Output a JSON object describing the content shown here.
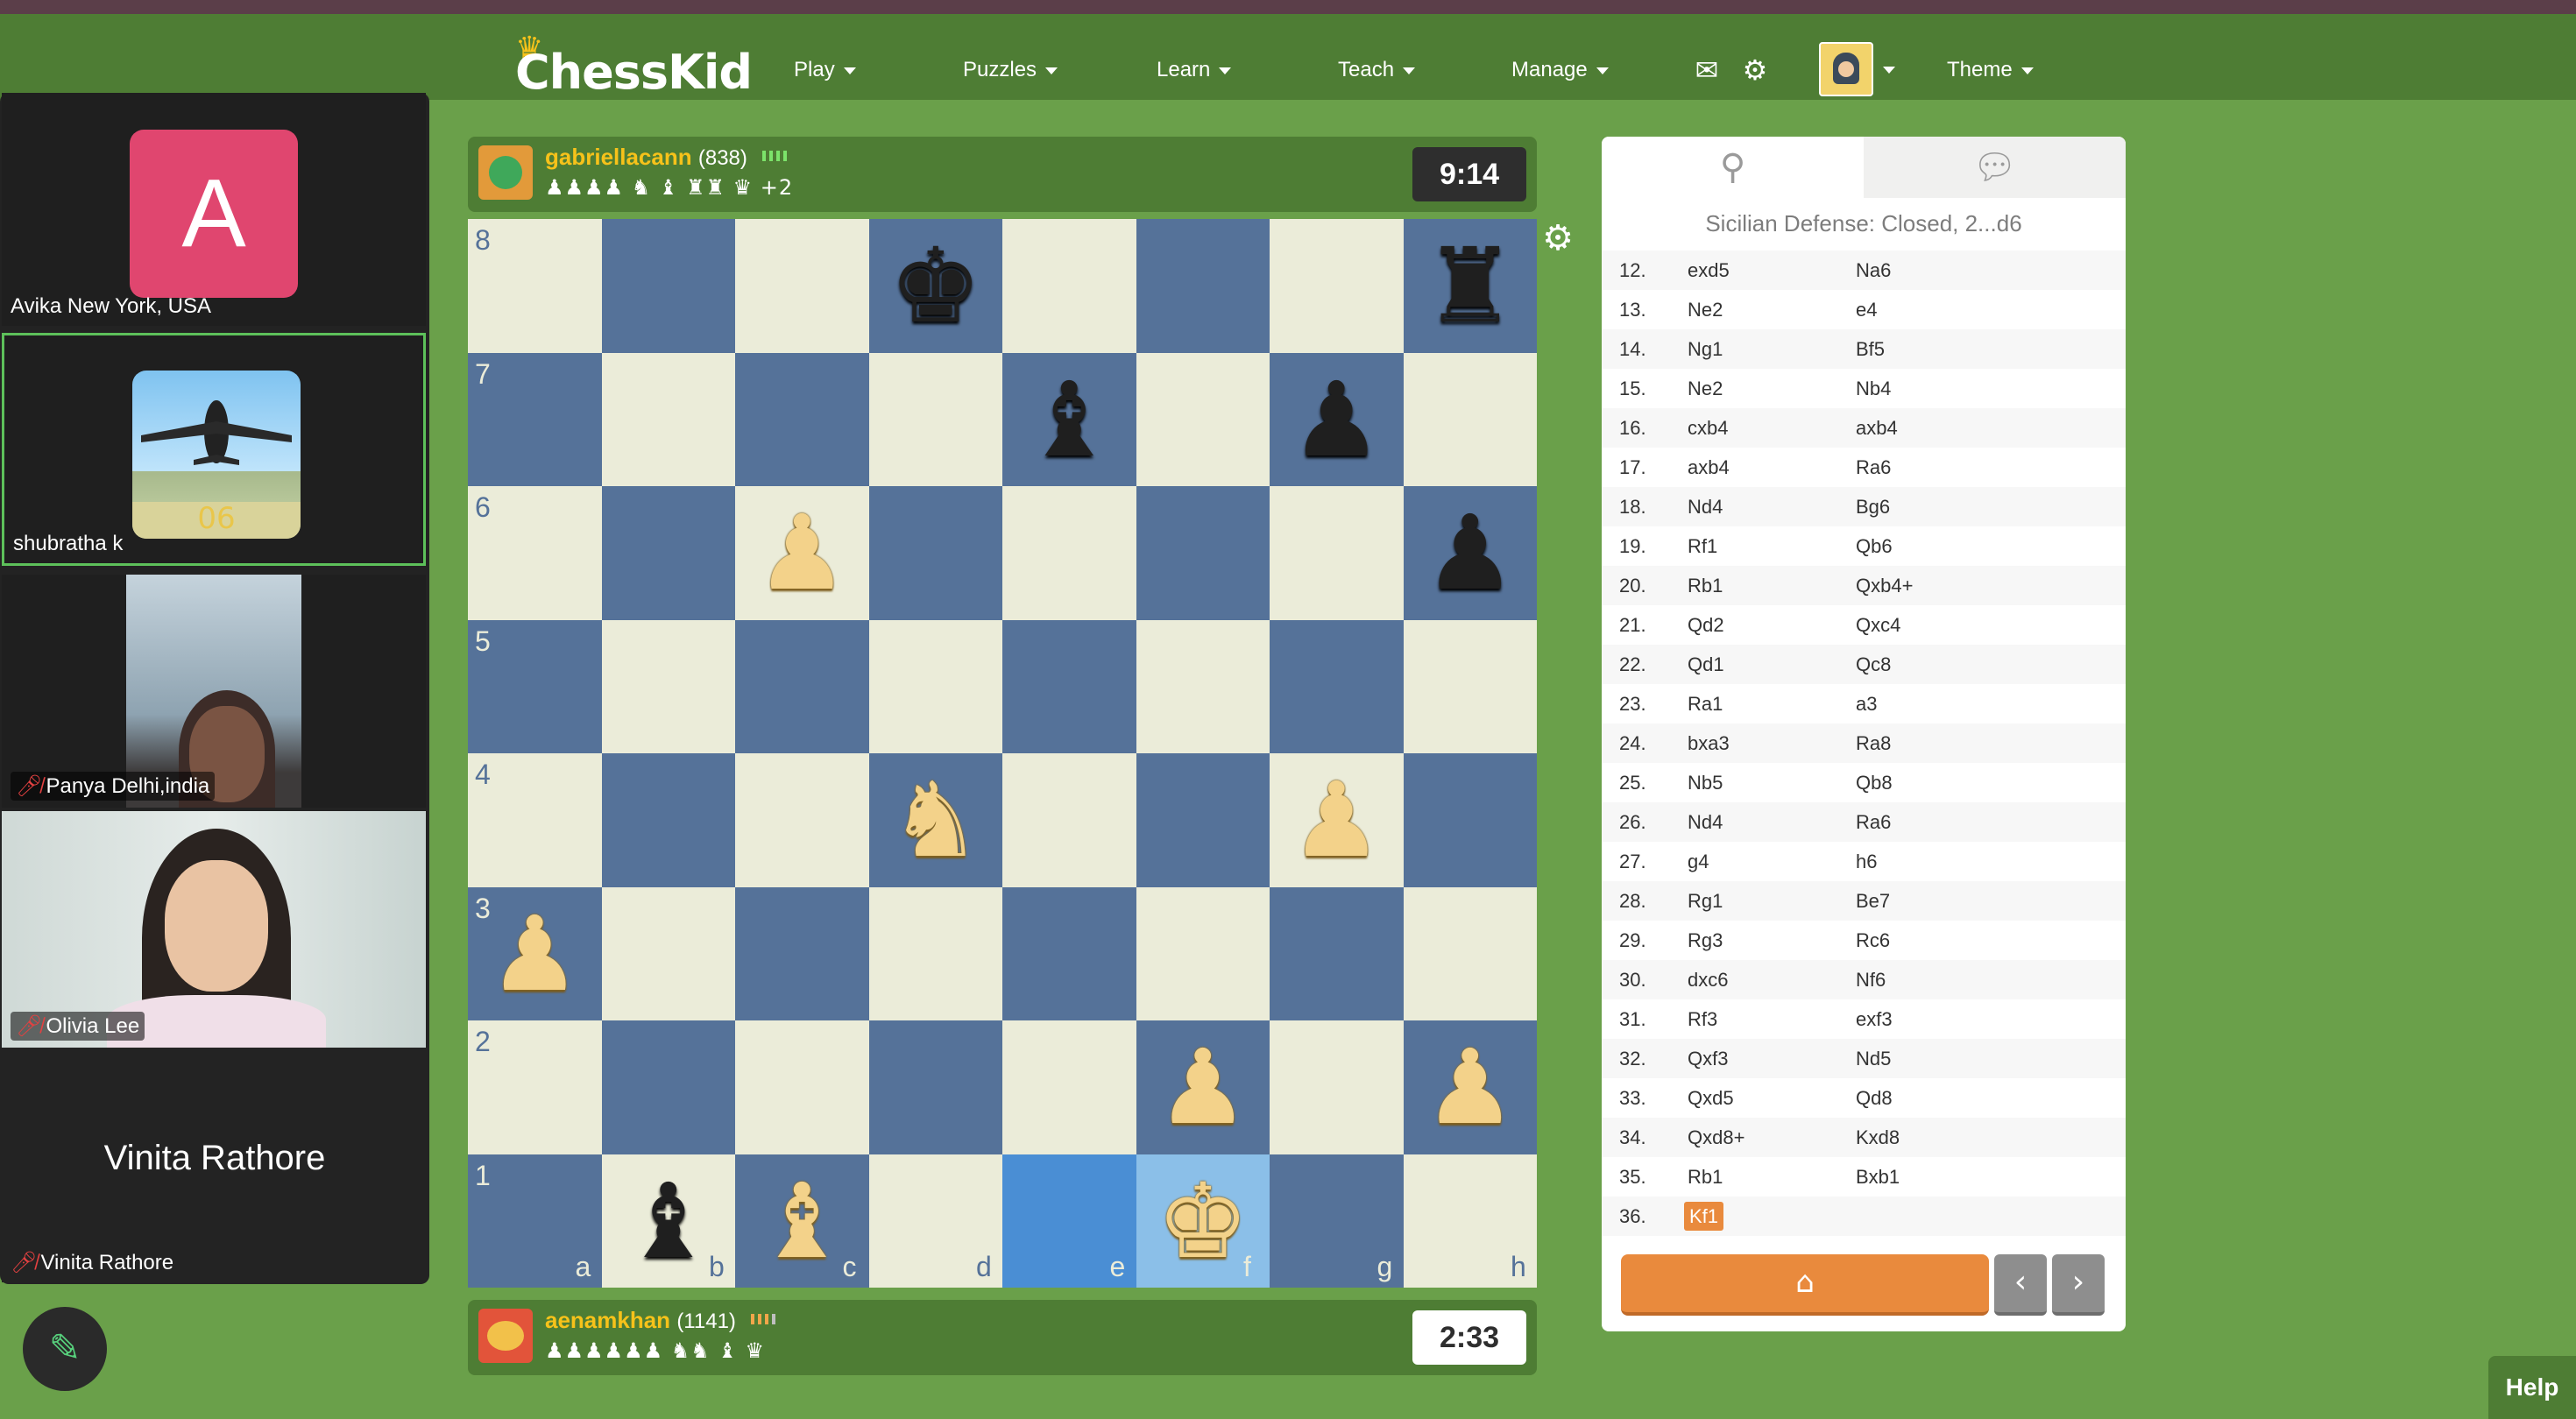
{
  "app": {
    "logo_text": "ChessKid"
  },
  "nav": {
    "items": [
      {
        "label": "Play"
      },
      {
        "label": "Puzzles"
      },
      {
        "label": "Learn"
      },
      {
        "label": "Teach"
      },
      {
        "label": "Manage"
      },
      {
        "label": "Theme"
      }
    ],
    "icons": [
      "mail-icon",
      "gear-icon"
    ]
  },
  "video": {
    "participants": [
      {
        "name": "Avika New York, USA",
        "avatar_letter": "A",
        "muted": false
      },
      {
        "name": "shubratha k",
        "muted": false,
        "active": true
      },
      {
        "name": "Panya Delhi,india",
        "muted": true
      },
      {
        "name": "Olivia Lee",
        "muted": true
      },
      {
        "name": "Vinita Rathore",
        "muted": true,
        "display_name": "Vinita Rathore"
      }
    ]
  },
  "top_player": {
    "name": "gabriellacann",
    "rating": "(838)",
    "captured": "♟♟♟♟ ♞ ♝ ♜♜ ♛",
    "captured_extra": "+2",
    "clock": "9:14"
  },
  "bottom_player": {
    "name": "aenamkhan",
    "rating": "(1141)",
    "captured": "♟♟♟♟♟♟ ♞♞ ♝ ♛",
    "clock": "2:33"
  },
  "board": {
    "files": [
      "a",
      "b",
      "c",
      "d",
      "e",
      "f",
      "g",
      "h"
    ],
    "ranks": [
      "8",
      "7",
      "6",
      "5",
      "4",
      "3",
      "2",
      "1"
    ],
    "pieces": [
      {
        "sq": "d8",
        "glyph": "♚",
        "color": "b"
      },
      {
        "sq": "h8",
        "glyph": "♜",
        "color": "b"
      },
      {
        "sq": "e7",
        "glyph": "♝",
        "color": "b"
      },
      {
        "sq": "g7",
        "glyph": "♟",
        "color": "b"
      },
      {
        "sq": "c6",
        "glyph": "♟",
        "color": "w"
      },
      {
        "sq": "h6",
        "glyph": "♟",
        "color": "b"
      },
      {
        "sq": "d4",
        "glyph": "♞",
        "color": "w"
      },
      {
        "sq": "g4",
        "glyph": "♟",
        "color": "w"
      },
      {
        "sq": "a3",
        "glyph": "♟",
        "color": "w"
      },
      {
        "sq": "f2",
        "glyph": "♟",
        "color": "w"
      },
      {
        "sq": "h2",
        "glyph": "♟",
        "color": "w"
      },
      {
        "sq": "b1",
        "glyph": "♝",
        "color": "b"
      },
      {
        "sq": "c1",
        "glyph": "♝",
        "color": "w"
      },
      {
        "sq": "f1",
        "glyph": "♚",
        "color": "w"
      }
    ],
    "highlight": [
      "e1",
      "f1"
    ]
  },
  "panel": {
    "opening": "Sicilian Defense: Closed, 2...d6",
    "tab_icons": [
      "analysis-icon",
      "chat-icon"
    ],
    "moves": [
      [
        "12.",
        "exd5",
        "Na6"
      ],
      [
        "13.",
        "Ne2",
        "e4"
      ],
      [
        "14.",
        "Ng1",
        "Bf5"
      ],
      [
        "15.",
        "Ne2",
        "Nb4"
      ],
      [
        "16.",
        "cxb4",
        "axb4"
      ],
      [
        "17.",
        "axb4",
        "Ra6"
      ],
      [
        "18.",
        "Nd4",
        "Bg6"
      ],
      [
        "19.",
        "Rf1",
        "Qb6"
      ],
      [
        "20.",
        "Rb1",
        "Qxb4+"
      ],
      [
        "21.",
        "Qd2",
        "Qxc4"
      ],
      [
        "22.",
        "Qd1",
        "Qc8"
      ],
      [
        "23.",
        "Ra1",
        "a3"
      ],
      [
        "24.",
        "bxa3",
        "Ra8"
      ],
      [
        "25.",
        "Nb5",
        "Qb8"
      ],
      [
        "26.",
        "Nd4",
        "Ra6"
      ],
      [
        "27.",
        "g4",
        "h6"
      ],
      [
        "28.",
        "Rg1",
        "Be7"
      ],
      [
        "29.",
        "Rg3",
        "Rc6"
      ],
      [
        "30.",
        "dxc6",
        "Nf6"
      ],
      [
        "31.",
        "Rf3",
        "exf3"
      ],
      [
        "32.",
        "Qxf3",
        "Nd5"
      ],
      [
        "33.",
        "Qxd5",
        "Qd8"
      ],
      [
        "34.",
        "Qxd8+",
        "Kxd8"
      ],
      [
        "35.",
        "Rb1",
        "Bxb1"
      ],
      [
        "36.",
        "Kf1",
        ""
      ]
    ],
    "current_move": "Kf1",
    "home_icon": "home-icon",
    "prev_icon": "chevron-left-icon",
    "next_icon": "chevron-right-icon"
  },
  "help": {
    "label": "Help"
  },
  "colors": {
    "bg": "#6aa04a",
    "nav": "#4e7d34",
    "dark_square": "#557299",
    "light_square": "#ebecd9",
    "accent": "#e98a3d"
  }
}
